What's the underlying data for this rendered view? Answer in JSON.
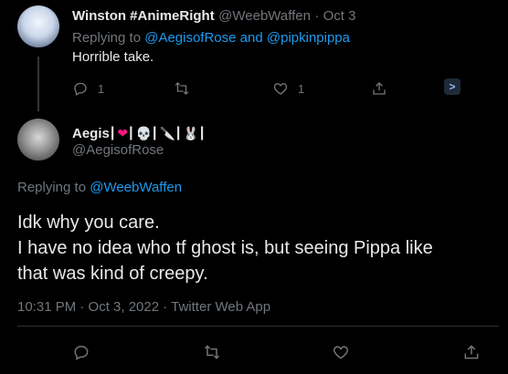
{
  "tweet1": {
    "display_name": "Winston #AnimeRight",
    "handle": "@WeebWaffen",
    "time": "· Oct 3",
    "replying_prefix": "Replying to",
    "replying_user1": "@AegisofRose",
    "replying_and": "and",
    "replying_user2": "@pipkinpippa",
    "text": "Horrible take.",
    "reply_count": "1",
    "like_count": "1"
  },
  "tweet2": {
    "display_name": "Aegis",
    "name_emoji": [
      "❤",
      "💀",
      "🔪",
      "🐰"
    ],
    "handle": "@AegisofRose",
    "replying_prefix": "Replying to",
    "replying_user": "@WeebWaffen",
    "text_line1": "Idk why you care.",
    "text_line2": "I have no idea who tf ghost is, but seeing Pippa like",
    "text_line3": "that was kind of creepy.",
    "meta": "10:31 PM · Oct 3, 2022 · Twitter Web App"
  },
  "colors": {
    "background": "#000000",
    "text": "#e7e9ea",
    "muted": "#71767b",
    "link": "#1d9bf0",
    "heart": "#f91880"
  }
}
